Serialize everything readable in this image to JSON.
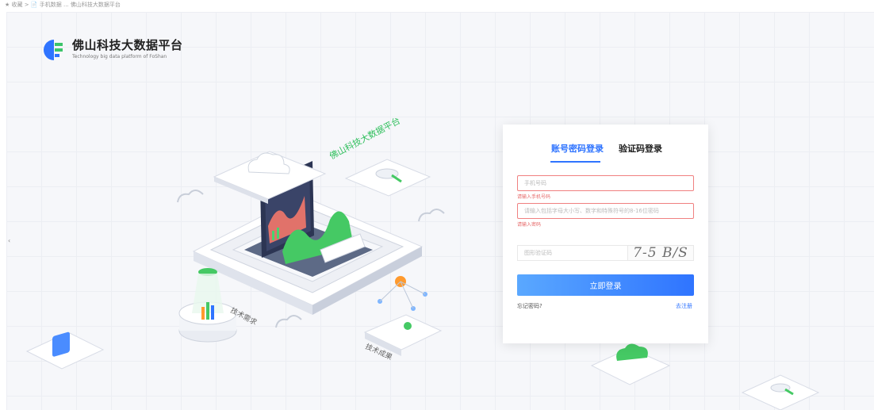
{
  "breadcrumb": {
    "text": "★ 收藏  >  📄 手机数据 ... 佛山科技大数据平台"
  },
  "logo": {
    "title": "佛山科技大数据平台",
    "subtitle": "Technology big data platform of FoShan"
  },
  "illustration": {
    "banner_text": "佛山科技大数据平台",
    "label_demand": "技术需求",
    "label_results": "技术成果"
  },
  "login": {
    "tab_password": "账号密码登录",
    "tab_code": "验证码登录",
    "phone_placeholder": "手机号码",
    "phone_error": "请输入手机号码",
    "password_placeholder": "请输入包括字母大小写、数字和特殊符号的8-16位密码",
    "password_error": "请输入密码",
    "captcha_placeholder": "图形验证码",
    "captcha_text": "7-5 B/S",
    "submit_label": "立即登录",
    "forgot_label": "忘记密码?",
    "register_label": "去注册"
  },
  "colors": {
    "accent": "#2f74ff",
    "error": "#e66a6a",
    "brand_green": "#3cc46a"
  }
}
